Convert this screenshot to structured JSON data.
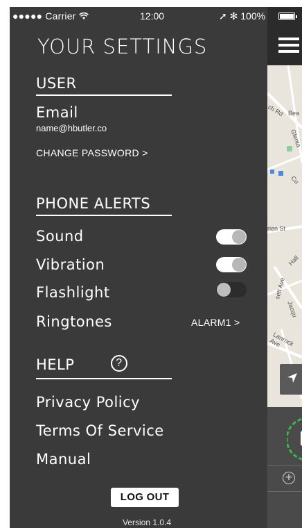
{
  "status_bar": {
    "signal": "●●●●● Carrier",
    "wifi_icon": "wifi-icon",
    "time": "12:00",
    "right": "➚ ✻ 100%"
  },
  "drawer": {
    "title": "YOUR SETTINGS",
    "user": {
      "heading": "USER",
      "email_label": "Email",
      "email_value": "name@hbutler.co",
      "change_password": "CHANGE PASSWORD >"
    },
    "phone_alerts": {
      "heading": "PHONE ALERTS",
      "items": [
        {
          "label": "Sound",
          "on": true
        },
        {
          "label": "Vibration",
          "on": true
        },
        {
          "label": "Flashlight",
          "on": false
        }
      ],
      "ringtones_label": "Ringtones",
      "ringtones_value": "ALARM1 >"
    },
    "help": {
      "heading": "HELP",
      "icon_glyph": "?",
      "links": [
        "Privacy Policy",
        "Terms Of Service",
        "Manual"
      ]
    },
    "logout": "LOG OUT",
    "version": "Version 1.0.4"
  },
  "map": {
    "labels": [
      "ch Rd",
      "Bea",
      "Glenta",
      "Cu",
      "rien St",
      "Hall",
      "sett Ave",
      "Jacqu",
      "Lanrock Ave"
    ]
  },
  "colors": {
    "drawer_bg": "#3a3a3a",
    "map_bg": "#e8e4dc",
    "gauge_green": "#3fb34f"
  }
}
